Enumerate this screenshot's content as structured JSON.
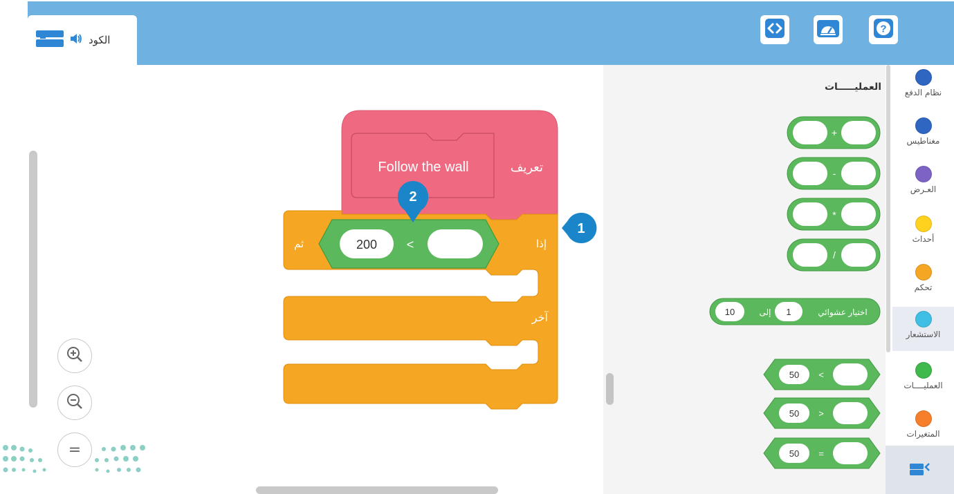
{
  "header": {
    "code_tab_label": "الكود",
    "buttons": [
      "code-view",
      "dashboard",
      "help"
    ],
    "help_label": "?"
  },
  "workspace": {
    "define_block": {
      "keyword": "تعريف",
      "name": "Follow the wall"
    },
    "if_block": {
      "if_label": "إذا",
      "then_label": "ثم",
      "else_label": "آخر"
    },
    "comparison": {
      "left_value": "200",
      "operator": "<",
      "right_value": ""
    },
    "markers": [
      {
        "number": "1"
      },
      {
        "number": "2"
      }
    ],
    "zoom_controls": [
      "zoom-in",
      "zoom-out",
      "zoom-reset"
    ],
    "zoom_reset_label": "="
  },
  "flyout": {
    "title": "العمليـــــات",
    "arith_ops": [
      "+",
      "-",
      "*",
      "/"
    ],
    "random": {
      "label": "اختيار عشوائي",
      "from": "1",
      "to_label": "إلى",
      "to": "10"
    },
    "compare_ops": [
      {
        "left": "50",
        "op": "<"
      },
      {
        "left": "50",
        "op": ">"
      },
      {
        "left": "50",
        "op": "="
      }
    ]
  },
  "categories": [
    {
      "name": "نظام الدفع",
      "color": "#2f66c2"
    },
    {
      "name": "مغناطيس",
      "color": "#2f66c2"
    },
    {
      "name": "العـرض",
      "color": "#7d64c4"
    },
    {
      "name": "أحداث",
      "color": "#ffd21f"
    },
    {
      "name": "تحكم",
      "color": "#f5a623"
    },
    {
      "name": "الاستشعار",
      "color": "#3fbfe3"
    },
    {
      "name": "العمليــــات",
      "color": "#3fb84c"
    },
    {
      "name": "المتغيرات",
      "color": "#f57f2a"
    }
  ],
  "selected_category": "الاستشعار",
  "colors": {
    "topbar": "#6fb1e0",
    "define_block": "#ef6a80",
    "control_block": "#f5a623",
    "operator_block": "#5cb85c",
    "marker": "#1a86c9"
  }
}
